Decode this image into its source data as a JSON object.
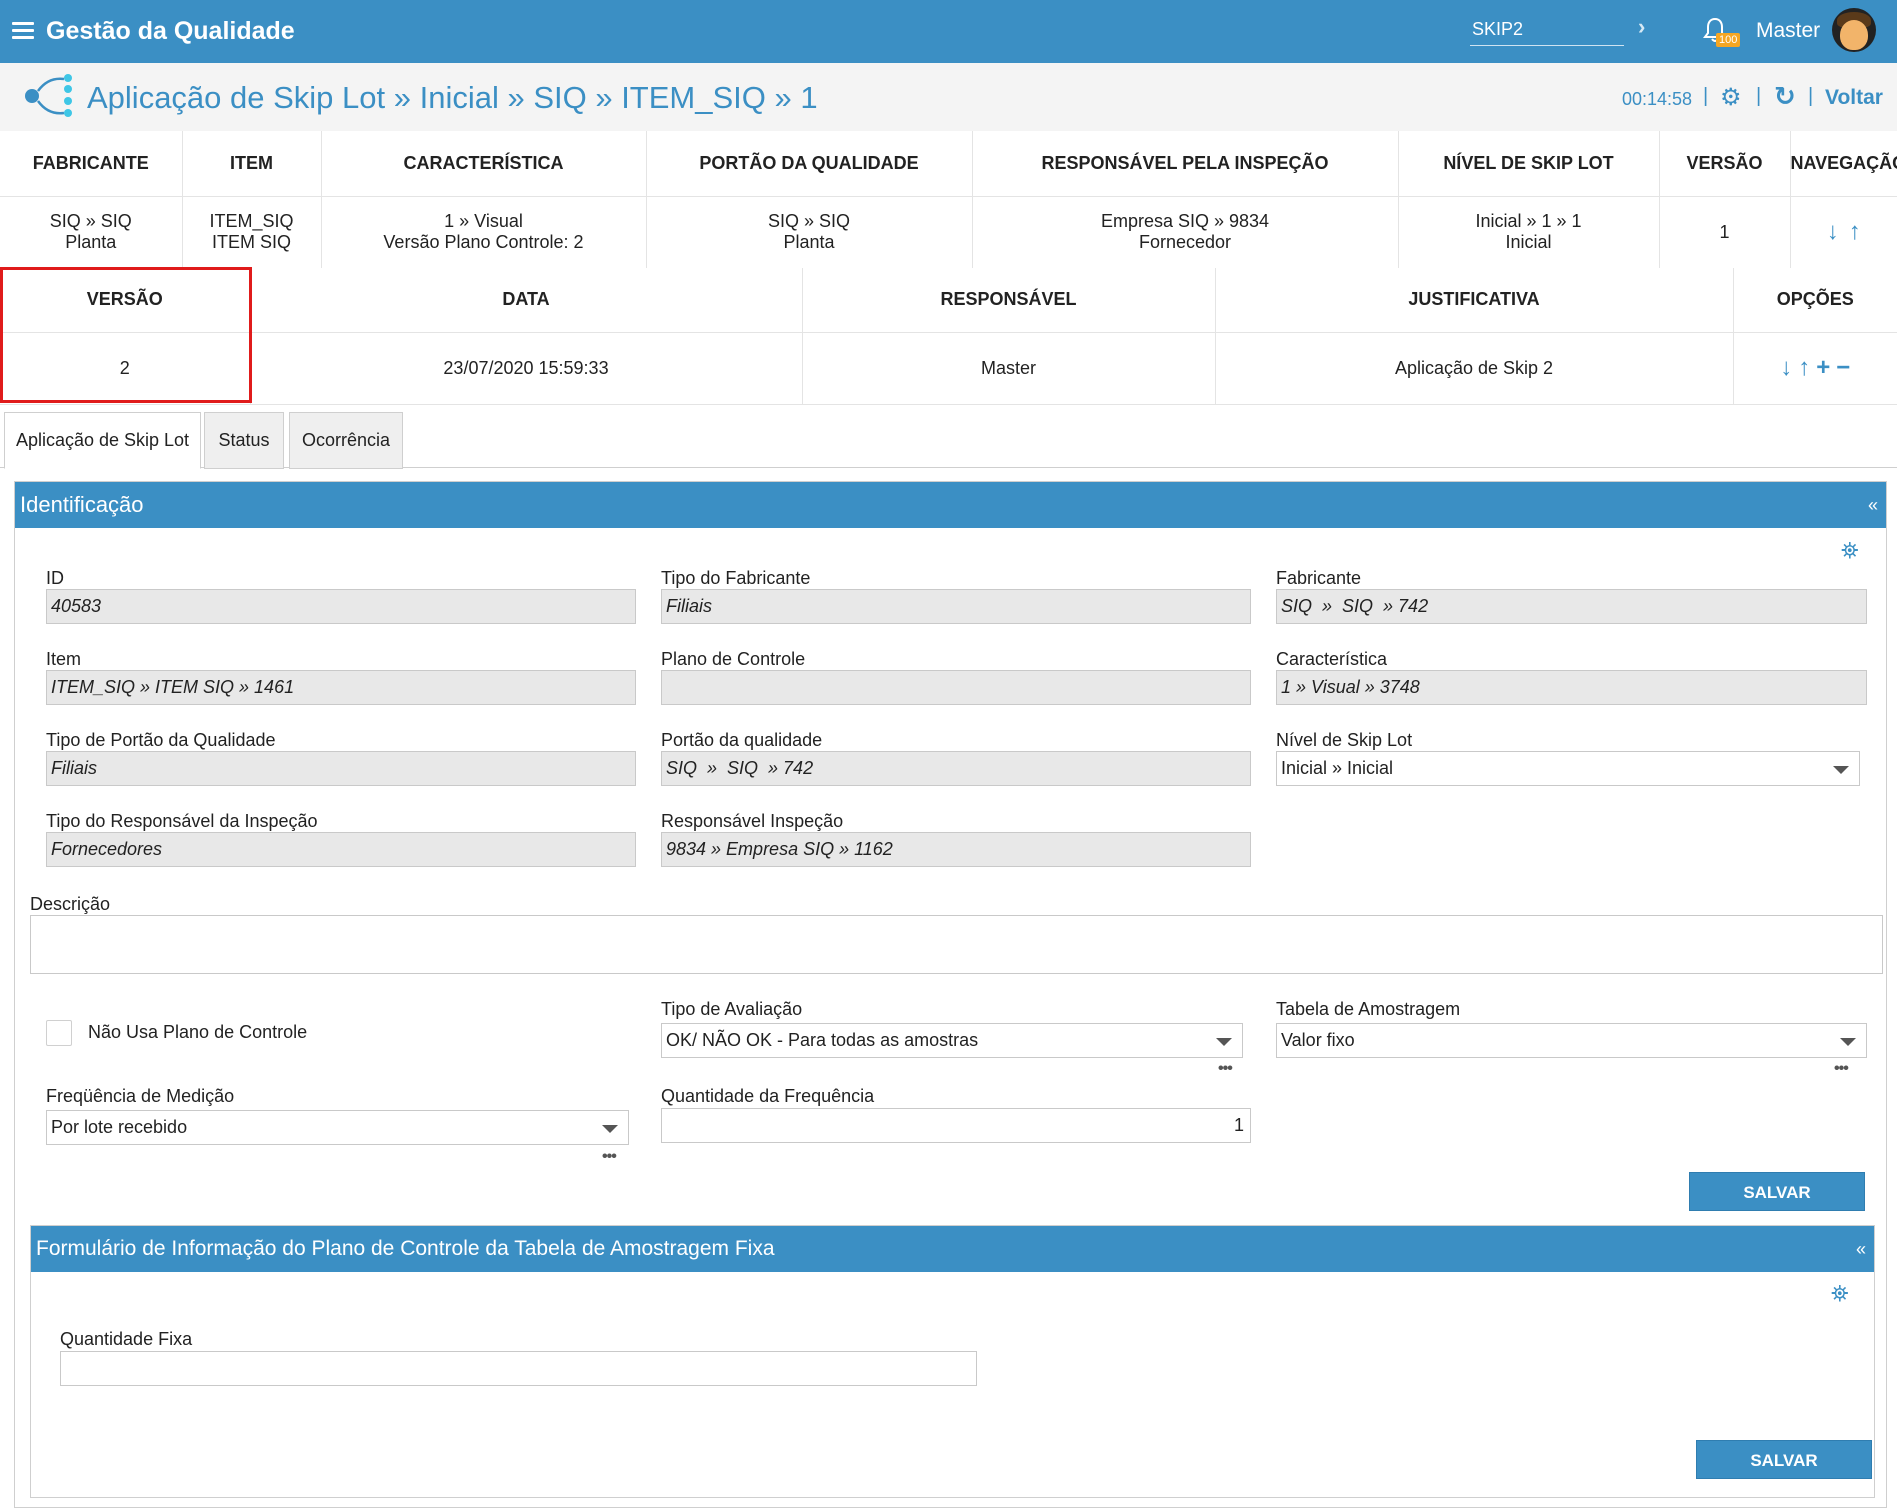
{
  "app": {
    "title": "Gestão da Qualidade",
    "search_value": "SKIP2",
    "notification_count": "100",
    "user_name": "Master"
  },
  "header": {
    "breadcrumb": "Aplicação de Skip Lot » Inicial » SIQ » ITEM_SIQ » 1",
    "timer": "00:14:58",
    "back_label": "Voltar"
  },
  "summary_table": {
    "headers": [
      "FABRICANTE",
      "ITEM",
      "CARACTERÍSTICA",
      "PORTÃO DA QUALIDADE",
      "RESPONSÁVEL PELA INSPEÇÃO",
      "NÍVEL DE SKIP LOT",
      "VERSÃO",
      "NAVEGAÇÃO"
    ],
    "row": {
      "fabricante": [
        "SIQ » SIQ",
        "Planta"
      ],
      "item": [
        "ITEM_SIQ",
        "ITEM SIQ"
      ],
      "caracteristica": [
        "1 » Visual",
        "Versão Plano Controle: 2"
      ],
      "portao": [
        "SIQ » SIQ",
        "Planta"
      ],
      "responsavel": [
        "Empresa SIQ » 9834",
        "Fornecedor"
      ],
      "nivel": [
        "Inicial » 1 » 1",
        "Inicial"
      ],
      "versao": "1"
    }
  },
  "version_table": {
    "headers": [
      "VERSÃO",
      "DATA",
      "RESPONSÁVEL",
      "JUSTIFICATIVA",
      "OPÇÕES"
    ],
    "row": {
      "versao": "2",
      "data": "23/07/2020 15:59:33",
      "responsavel": "Master",
      "justificativa": "Aplicação de Skip 2"
    }
  },
  "tabs": [
    {
      "label": "Aplicação de Skip Lot",
      "active": true
    },
    {
      "label": "Status",
      "active": false
    },
    {
      "label": "Ocorrência",
      "active": false
    }
  ],
  "identificacao": {
    "title": "Identificação",
    "fields": {
      "id": {
        "label": "ID",
        "value": "40583"
      },
      "tipo_fabricante": {
        "label": "Tipo do Fabricante",
        "value": "Filiais"
      },
      "fabricante": {
        "label": "Fabricante",
        "value": "SIQ  »  SIQ  » 742"
      },
      "item": {
        "label": "Item",
        "value": "ITEM_SIQ » ITEM SIQ » 1461"
      },
      "plano_controle": {
        "label": "Plano de Controle",
        "value": ""
      },
      "caracteristica": {
        "label": "Característica",
        "value": "1 » Visual » 3748"
      },
      "tipo_portao": {
        "label": "Tipo de Portão da Qualidade",
        "value": "Filiais"
      },
      "portao": {
        "label": "Portão da qualidade",
        "value": "SIQ  »  SIQ  » 742"
      },
      "nivel_skip": {
        "label": "Nível de Skip Lot",
        "value": "Inicial » Inicial"
      },
      "tipo_responsavel": {
        "label": "Tipo do Responsável da Inspeção",
        "value": "Fornecedores"
      },
      "responsavel": {
        "label": "Responsável Inspeção",
        "value": "9834 » Empresa SIQ » 1162"
      },
      "descricao": {
        "label": "Descrição",
        "value": ""
      },
      "nao_usa_plano": {
        "label": "Não Usa Plano de Controle",
        "checked": false
      },
      "tipo_avaliacao": {
        "label": "Tipo de Avaliação",
        "value": "OK/ NÃO OK - Para todas as amostras"
      },
      "tabela_amostragem": {
        "label": "Tabela de Amostragem",
        "value": "Valor fixo"
      },
      "frequencia": {
        "label": "Freqüência de Medição",
        "value": "Por lote recebido"
      },
      "qtd_frequencia": {
        "label": "Quantidade da Frequência",
        "value": "1"
      }
    },
    "save_label": "SALVAR"
  },
  "formulario": {
    "title": "Formulário de Informação do Plano de Controle da Tabela de Amostragem Fixa",
    "qtd_fixa": {
      "label": "Quantidade Fixa",
      "value": ""
    },
    "save_label": "SALVAR"
  },
  "colors": {
    "accent": "#3b8fc4",
    "highlight": "#e01b1b",
    "badge": "#f5a623"
  }
}
